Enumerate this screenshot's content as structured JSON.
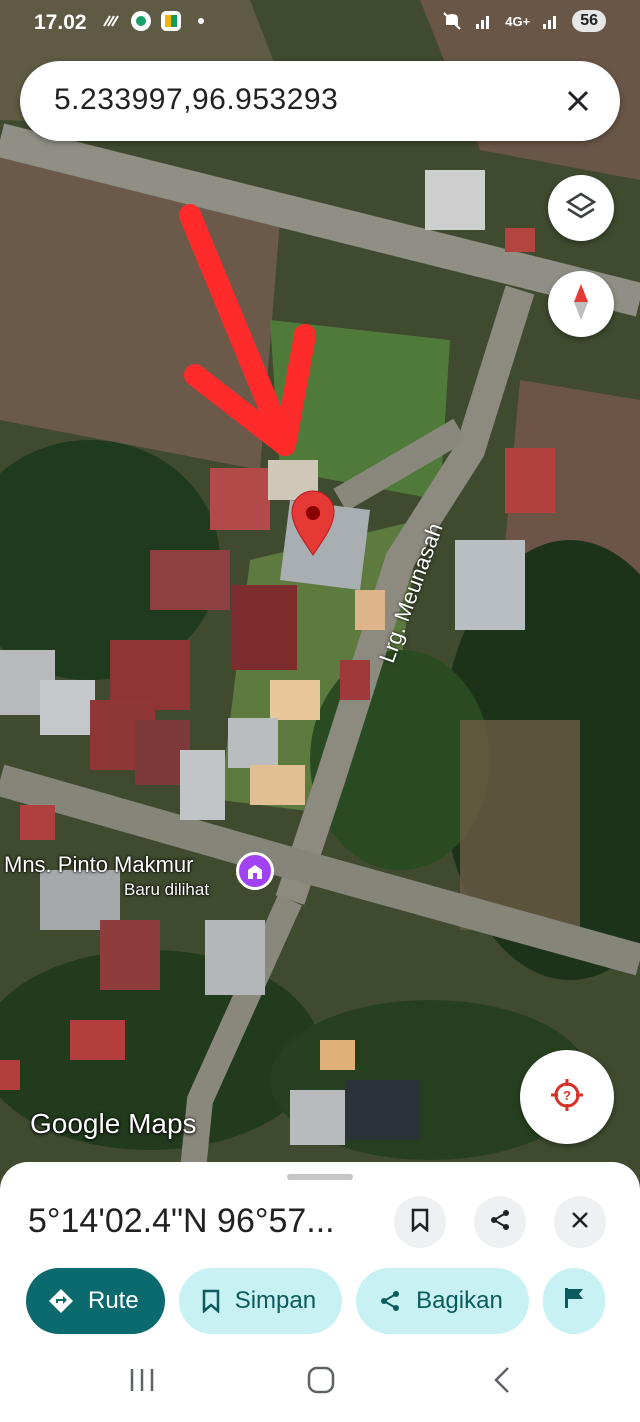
{
  "status_bar": {
    "time": "17.02",
    "network": "4G+",
    "battery": "56"
  },
  "search": {
    "query": "5.233997,96.953293"
  },
  "map": {
    "road_label": "Lrg. Meunasah",
    "place_name": "Mns. Pinto Makmur",
    "place_subtitle": "Baru dilihat",
    "watermark": "Google Maps"
  },
  "sheet": {
    "title": "5°14'02.4\"N 96°57...",
    "chips": {
      "route": "Rute",
      "save": "Simpan",
      "share": "Bagikan"
    }
  },
  "colors": {
    "primary": "#0b6a6e",
    "chip_bg": "#c8f1f3",
    "pin": "#e53935",
    "poi": "#a142f4",
    "arrow": "#ff2a2a"
  },
  "icons": [
    "layers-icon",
    "compass-icon",
    "locate-icon",
    "bookmark-icon",
    "share-icon",
    "close-icon",
    "directions-icon",
    "flag-icon"
  ]
}
